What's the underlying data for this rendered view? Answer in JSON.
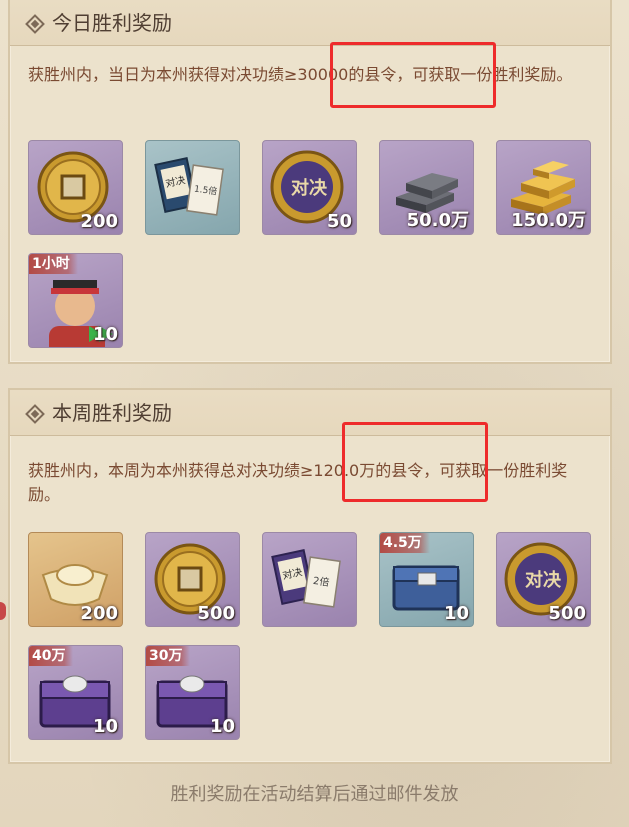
{
  "daily": {
    "title": "今日胜利奖励",
    "desc_before": "获胜州内，当日为本州获得对决功",
    "desc_highlight": "绩≥30000的县令",
    "desc_after": "，可获取一份胜利奖励。",
    "rewards": [
      {
        "name": "铜钱",
        "qty": "200",
        "color": "purple"
      },
      {
        "name": "对决加成券",
        "qty": "",
        "color": "blue"
      },
      {
        "name": "对决币",
        "qty": "50",
        "color": "purple"
      },
      {
        "name": "银锭",
        "qty": "50.0万",
        "color": "purple"
      },
      {
        "name": "金锭",
        "qty": "150.0万",
        "color": "purple"
      },
      {
        "name": "加速卡",
        "qty": "10",
        "tag": "1小时",
        "color": "purple"
      }
    ],
    "ticket_text": {
      "left": "对决",
      "right": "1.5倍"
    }
  },
  "weekly": {
    "title": "本周胜利奖励",
    "desc_before": "获胜州内，本周为本州获得总对决功",
    "desc_highlight": "绩≥120.0万的县令",
    "desc_after": "，可获取一份胜利奖励。",
    "rewards": [
      {
        "name": "元宝",
        "qty": "200",
        "color": "orange"
      },
      {
        "name": "铜钱",
        "qty": "500",
        "color": "purple"
      },
      {
        "name": "对决加成券",
        "qty": "",
        "color": "purple"
      },
      {
        "name": "银箱",
        "qty": "10",
        "tag": "4.5万",
        "color": "blue"
      },
      {
        "name": "对决币",
        "qty": "500",
        "color": "purple"
      },
      {
        "name": "宝箱",
        "qty": "10",
        "tag": "40万",
        "color": "purple"
      },
      {
        "name": "宝箱",
        "qty": "10",
        "tag": "30万",
        "color": "purple"
      }
    ],
    "ticket_text": {
      "left": "对决",
      "right": "2倍"
    }
  },
  "coin_text": "对决",
  "footer": "胜利奖励在活动结算后通过邮件发放",
  "colors": {
    "highlight": "#ee2b2b",
    "desc": "#7a4a32",
    "tag": "#b34b45"
  }
}
